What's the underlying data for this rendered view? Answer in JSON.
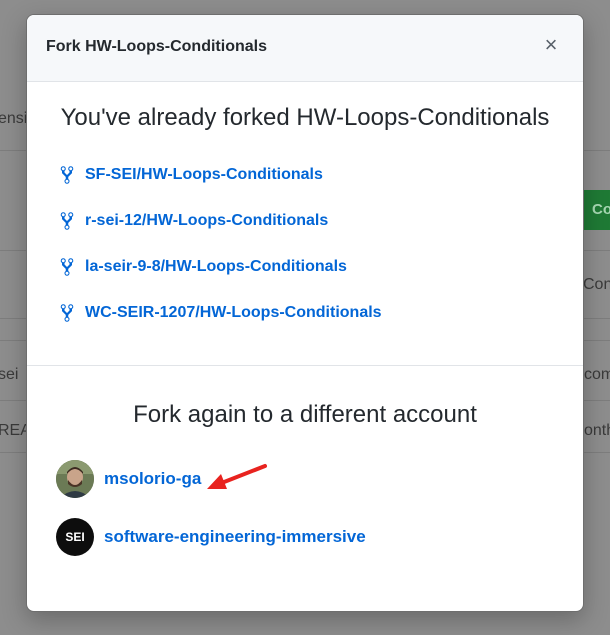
{
  "background": {
    "fragments": [
      "ensi",
      "Co",
      "Con",
      "sei",
      "com",
      "REA",
      "onth"
    ]
  },
  "modal": {
    "title": "Fork HW-Loops-Conditionals",
    "close_glyph": "×",
    "forked_heading": "You've already forked HW-Loops-Conditionals",
    "forks": [
      {
        "label": "SF-SEI/HW-Loops-Conditionals",
        "icon": "repo-forked-icon"
      },
      {
        "label": "r-sei-12/HW-Loops-Conditionals",
        "icon": "repo-forked-icon"
      },
      {
        "label": "la-seir-9-8/HW-Loops-Conditionals",
        "icon": "repo-forked-icon"
      },
      {
        "label": "WC-SEIR-1207/HW-Loops-Conditionals",
        "icon": "repo-forked-icon"
      }
    ],
    "fork_again_heading": "Fork again to a different account",
    "accounts": [
      {
        "name": "msolorio-ga",
        "avatar": "user-avatar"
      },
      {
        "name": "software-engineering-immersive",
        "avatar": "org-avatar",
        "avatar_text": "SEI"
      }
    ]
  },
  "colors": {
    "link": "#0366d6",
    "annotation_arrow": "#e8231f",
    "overlay": "#8d8d8d"
  }
}
